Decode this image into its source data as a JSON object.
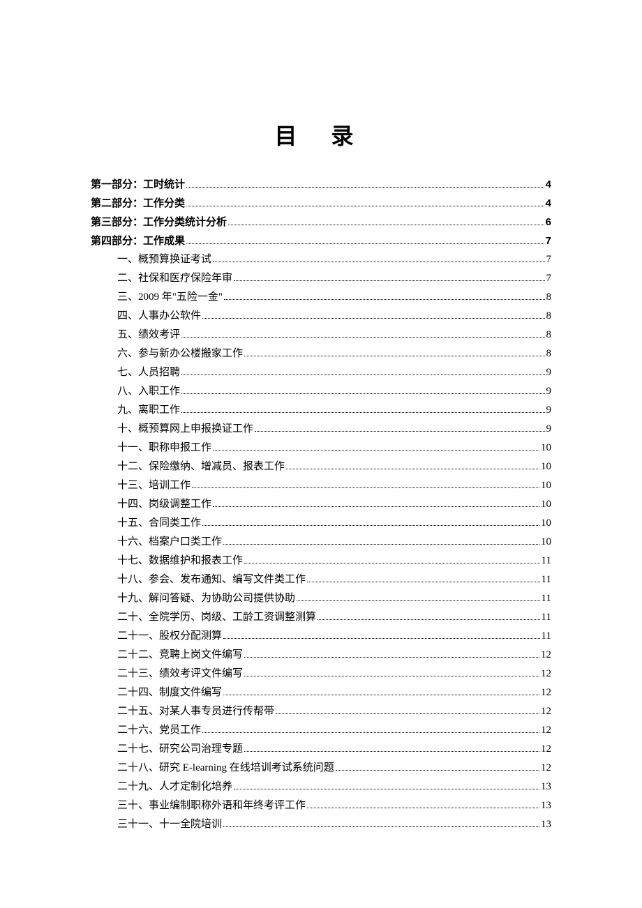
{
  "title": "目  录",
  "entries": [
    {
      "level": 1,
      "label": "第一部分：工时统计",
      "page": "4"
    },
    {
      "level": 1,
      "label": "第二部分：工作分类",
      "page": "4"
    },
    {
      "level": 1,
      "label": "第三部分：工作分类统计分析",
      "page": "6"
    },
    {
      "level": 1,
      "label": "第四部分：工作成果",
      "page": "7"
    },
    {
      "level": 2,
      "label": "一、概预算换证考试",
      "page": "7"
    },
    {
      "level": 2,
      "label": "二、社保和医疗保险年审",
      "page": "7"
    },
    {
      "level": 2,
      "label": "三、2009 年\"五险一金\"",
      "page": "8"
    },
    {
      "level": 2,
      "label": "四、人事办公软件",
      "page": "8"
    },
    {
      "level": 2,
      "label": "五、绩效考评",
      "page": "8"
    },
    {
      "level": 2,
      "label": "六、参与新办公楼搬家工作",
      "page": "8"
    },
    {
      "level": 2,
      "label": "七、人员招聘",
      "page": "9"
    },
    {
      "level": 2,
      "label": "八、入职工作",
      "page": "9"
    },
    {
      "level": 2,
      "label": "九、离职工作",
      "page": "9"
    },
    {
      "level": 2,
      "label": "十、概预算网上申报换证工作",
      "page": "9"
    },
    {
      "level": 2,
      "label": "十一、职称申报工作",
      "page": "10"
    },
    {
      "level": 2,
      "label": "十二、保险缴纳、增减员、报表工作",
      "page": "10"
    },
    {
      "level": 2,
      "label": "十三、培训工作",
      "page": "10"
    },
    {
      "level": 2,
      "label": "十四、岗级调整工作",
      "page": "10"
    },
    {
      "level": 2,
      "label": "十五、合同类工作",
      "page": "10"
    },
    {
      "level": 2,
      "label": "十六、档案户口类工作",
      "page": "10"
    },
    {
      "level": 2,
      "label": "十七、数据维护和报表工作",
      "page": "11"
    },
    {
      "level": 2,
      "label": "十八、参会、发布通知、编写文件类工作",
      "page": "11"
    },
    {
      "level": 2,
      "label": "十九、解问答疑、为协助公司提供协助",
      "page": "11"
    },
    {
      "level": 2,
      "label": "二十、全院学历、岗级、工龄工资调整测算",
      "page": "11"
    },
    {
      "level": 2,
      "label": "二十一、股权分配测算",
      "page": "11"
    },
    {
      "level": 2,
      "label": "二十二、竞聘上岗文件编写",
      "page": "12"
    },
    {
      "level": 2,
      "label": "二十三、绩效考评文件编写",
      "page": "12"
    },
    {
      "level": 2,
      "label": "二十四、制度文件编写",
      "page": "12"
    },
    {
      "level": 2,
      "label": "二十五、对某人事专员进行传帮带",
      "page": "12"
    },
    {
      "level": 2,
      "label": "二十六、党员工作",
      "page": "12"
    },
    {
      "level": 2,
      "label": "二十七、研究公司治理专题",
      "page": "12"
    },
    {
      "level": 2,
      "label": "二十八、研究 E-learning 在线培训考试系统问题",
      "page": "12"
    },
    {
      "level": 2,
      "label": "二十九、人才定制化培养",
      "page": "13"
    },
    {
      "level": 2,
      "label": "三十、事业编制职称外语和年终考评工作",
      "page": "13"
    },
    {
      "level": 2,
      "label": "三十一、十一全院培训",
      "page": "13"
    }
  ]
}
